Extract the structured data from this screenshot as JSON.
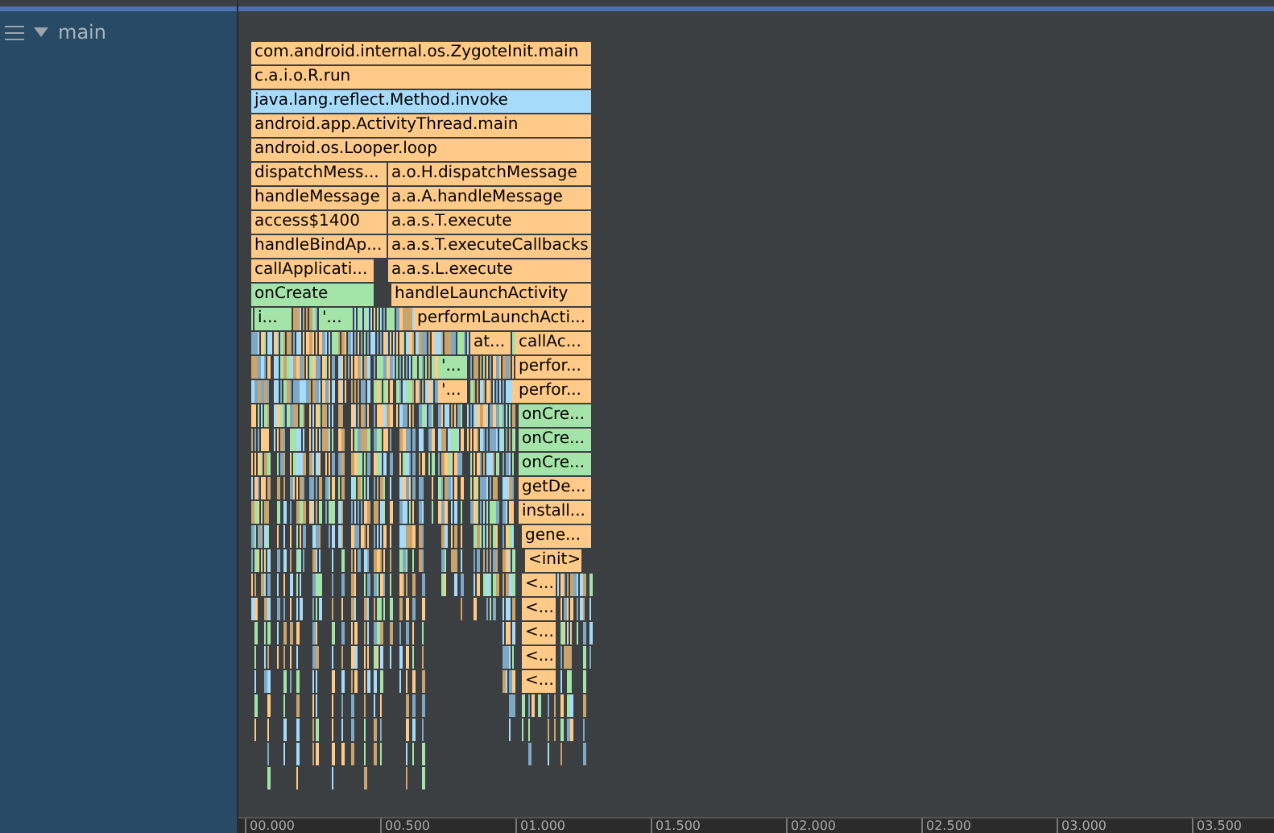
{
  "thread_list": {
    "threads": [
      {
        "name": "main",
        "expanded": true
      }
    ]
  },
  "flame_chart": {
    "rows": [
      [
        {
          "label": "com.android.internal.os.ZygoteInit.main",
          "color": "#ffc987"
        }
      ],
      [
        {
          "label": "c.a.i.o.R.run",
          "color": "#ffc987"
        }
      ],
      [
        {
          "label": "java.lang.reflect.Method.invoke",
          "color": "#a6dcfa"
        }
      ],
      [
        {
          "label": "android.app.ActivityThread.main",
          "color": "#ffc987"
        }
      ],
      [
        {
          "label": "android.os.Looper.loop",
          "color": "#ffc987"
        }
      ],
      [
        {
          "label": "dispatchMess...",
          "color": "#ffc987"
        },
        {
          "label": "a.o.H.dispatchMessage",
          "color": "#ffc987"
        }
      ],
      [
        {
          "label": "handleMessage",
          "color": "#ffc987"
        },
        {
          "label": "a.a.A.handleMessage",
          "color": "#ffc987"
        }
      ],
      [
        {
          "label": "access$1400",
          "color": "#ffc987"
        },
        {
          "label": "a.a.s.T.execute",
          "color": "#ffc987"
        }
      ],
      [
        {
          "label": "handleBindAp...",
          "color": "#ffc987"
        },
        {
          "label": "a.a.s.T.executeCallbacks",
          "color": "#ffc987"
        }
      ],
      [
        {
          "label": "callApplicati...",
          "color": "#ffc987"
        },
        {
          "label": "a.a.s.L.execute",
          "color": "#ffc987"
        }
      ],
      [
        {
          "label": "onCreate",
          "color": "#a4e4a8"
        },
        {
          "label": "handleLaunchActivity",
          "color": "#ffc987"
        }
      ],
      [
        {
          "label": "i...",
          "color": "#a4e4a8"
        },
        {
          "label": "'...",
          "color": "#a4e4a8"
        },
        {
          "label": "performLaunchActi...",
          "color": "#ffc987"
        }
      ],
      [
        {
          "label": "at...",
          "color": "#ffc987"
        },
        {
          "label": "callAc...",
          "color": "#ffc987"
        }
      ],
      [
        {
          "label": "'...",
          "color": "#a4e4a8"
        },
        {
          "label": "perfor...",
          "color": "#ffc987"
        }
      ],
      [
        {
          "label": "'...",
          "color": "#ffc987"
        },
        {
          "label": "perfor...",
          "color": "#ffc987"
        }
      ],
      [
        {
          "label": "onCre...",
          "color": "#a4e4a8"
        }
      ],
      [
        {
          "label": "onCre...",
          "color": "#a4e4a8"
        }
      ],
      [
        {
          "label": "onCre...",
          "color": "#a4e4a8"
        }
      ],
      [
        {
          "label": "getDe...",
          "color": "#ffc987"
        }
      ],
      [
        {
          "label": "install...",
          "color": "#ffc987"
        }
      ],
      [
        {
          "label": "gene...",
          "color": "#ffc987"
        }
      ],
      [
        {
          "label": "<init>",
          "color": "#ffc987"
        }
      ],
      [
        {
          "label": "<...",
          "color": "#ffc987"
        }
      ],
      [
        {
          "label": "<...",
          "color": "#ffc987"
        }
      ],
      [
        {
          "label": "<...",
          "color": "#ffc987"
        }
      ],
      [
        {
          "label": "<...",
          "color": "#ffc987"
        }
      ],
      [
        {
          "label": "<...",
          "color": "#ffc987"
        }
      ]
    ]
  },
  "time_axis": {
    "ticks": [
      "00.000",
      "00.500",
      "01.000",
      "01.500",
      "02.000",
      "02.500",
      "03.000",
      "03.500"
    ]
  }
}
